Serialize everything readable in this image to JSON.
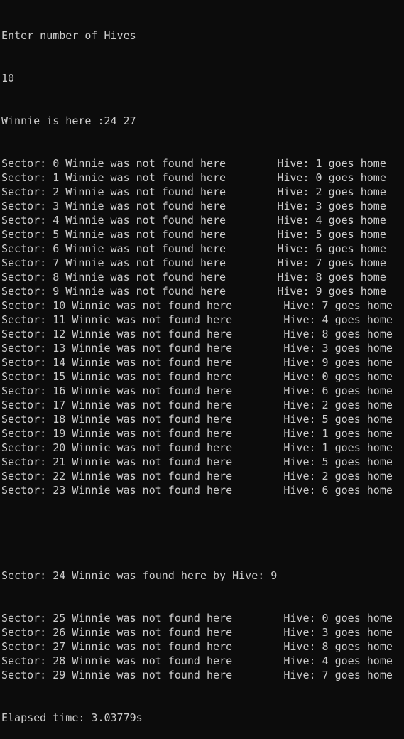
{
  "console": {
    "prompt": "Enter number of Hives",
    "input_value": "10",
    "winnie_location": "Winnie is here :24 27",
    "elapsed": "Elapsed time: 3.03779s",
    "lines_before_found": [
      "Sector: 0 Winnie was not found here        Hive: 1 goes home",
      "Sector: 1 Winnie was not found here        Hive: 0 goes home",
      "Sector: 2 Winnie was not found here        Hive: 2 goes home",
      "Sector: 3 Winnie was not found here        Hive: 3 goes home",
      "Sector: 4 Winnie was not found here        Hive: 4 goes home",
      "Sector: 5 Winnie was not found here        Hive: 5 goes home",
      "Sector: 6 Winnie was not found here        Hive: 6 goes home",
      "Sector: 7 Winnie was not found here        Hive: 7 goes home",
      "Sector: 8 Winnie was not found here        Hive: 8 goes home",
      "Sector: 9 Winnie was not found here        Hive: 9 goes home",
      "Sector: 10 Winnie was not found here        Hive: 7 goes home",
      "Sector: 11 Winnie was not found here        Hive: 4 goes home",
      "Sector: 12 Winnie was not found here        Hive: 8 goes home",
      "Sector: 13 Winnie was not found here        Hive: 3 goes home",
      "Sector: 14 Winnie was not found here        Hive: 9 goes home",
      "Sector: 15 Winnie was not found here        Hive: 0 goes home",
      "Sector: 16 Winnie was not found here        Hive: 6 goes home",
      "Sector: 17 Winnie was not found here        Hive: 2 goes home",
      "Sector: 18 Winnie was not found here        Hive: 5 goes home",
      "Sector: 19 Winnie was not found here        Hive: 1 goes home",
      "Sector: 20 Winnie was not found here        Hive: 1 goes home",
      "Sector: 21 Winnie was not found here        Hive: 5 goes home",
      "Sector: 22 Winnie was not found here        Hive: 2 goes home",
      "Sector: 23 Winnie was not found here        Hive: 6 goes home"
    ],
    "found_line": "Sector: 24 Winnie was found here by Hive: 9",
    "lines_after_found": [
      "Sector: 25 Winnie was not found here        Hive: 0 goes home",
      "Sector: 26 Winnie was not found here        Hive: 3 goes home",
      "Sector: 27 Winnie was not found here        Hive: 8 goes home",
      "Sector: 28 Winnie was not found here        Hive: 4 goes home",
      "Sector: 29 Winnie was not found here        Hive: 7 goes home"
    ]
  }
}
